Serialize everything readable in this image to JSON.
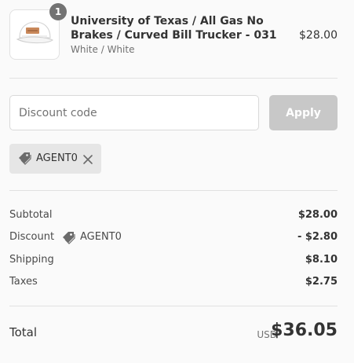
{
  "product": {
    "quantity": "1",
    "title": "University of Texas / All Gas No Brakes / Curved Bill Trucker - 031",
    "variant": "White / White",
    "price": "$28.00",
    "image_icon": "trucker-hat-image"
  },
  "discount": {
    "placeholder": "Discount code",
    "apply_label": "Apply",
    "applied_code": "AGENT0",
    "tag_icon": "tag-icon",
    "remove_icon": "close-icon"
  },
  "summary": {
    "rows": [
      {
        "label": "Subtotal",
        "value": "$28.00"
      },
      {
        "label": "Discount",
        "code": "AGENT0",
        "value": "- $2.80"
      },
      {
        "label": "Shipping",
        "value": "$8.10"
      },
      {
        "label": "Taxes",
        "value": "$2.75"
      }
    ],
    "total_label": "Total",
    "currency": "USD",
    "total_value": "$36.05"
  },
  "colors": {
    "background": "#fafafa",
    "badge": "#737373",
    "apply_disabled": "#c8c8c8",
    "chip": "#e6e6e6",
    "divider": "#e1e1e1"
  }
}
